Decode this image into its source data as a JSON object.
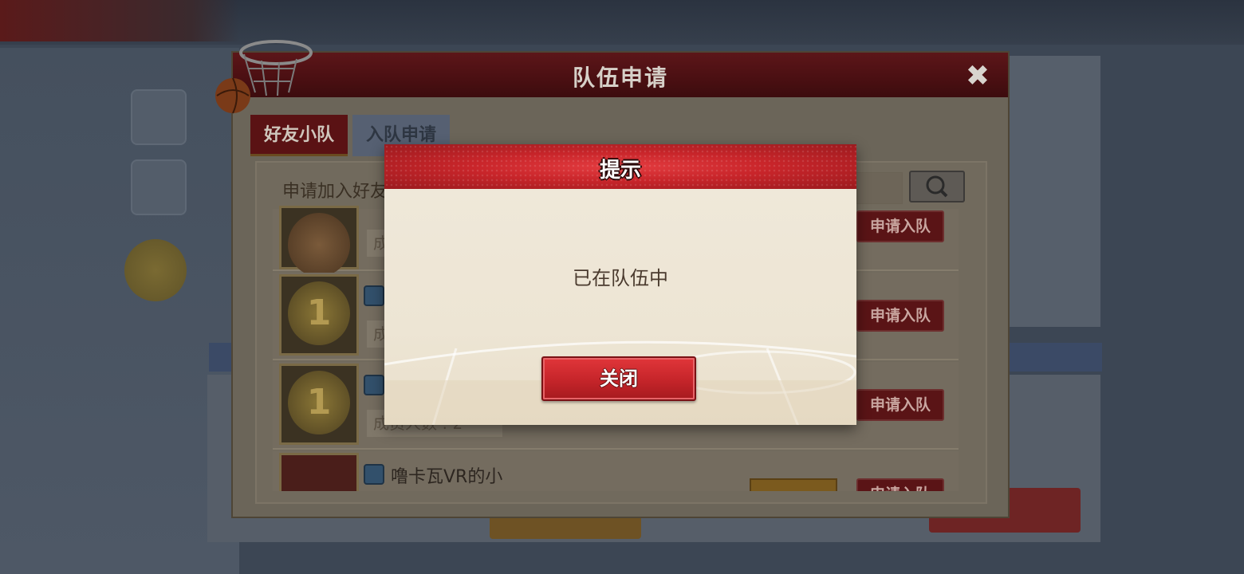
{
  "dialog": {
    "title": "队伍申请",
    "close_icon": "close-icon",
    "tabs": [
      {
        "label": "好友小队",
        "active": true
      },
      {
        "label": "入队申请",
        "active": false
      }
    ],
    "search": {
      "label": "申请加入好友",
      "icon": "search-icon"
    },
    "rows": [
      {
        "name": "",
        "sub": "成",
        "button": "申请入队"
      },
      {
        "name": "",
        "sub": "成",
        "button": "申请入队"
      },
      {
        "name": "",
        "sub": "成员人数 : 2",
        "button": "申请入队"
      },
      {
        "name": "噜卡瓦VR的小",
        "sub": "",
        "button": "申请入队"
      }
    ]
  },
  "alert": {
    "title": "提示",
    "message": "已在队伍中",
    "close_button": "关闭"
  },
  "colors": {
    "alert_header": "#c8252a",
    "alert_button": "#c8262b",
    "alert_body": "#efe7d7"
  }
}
